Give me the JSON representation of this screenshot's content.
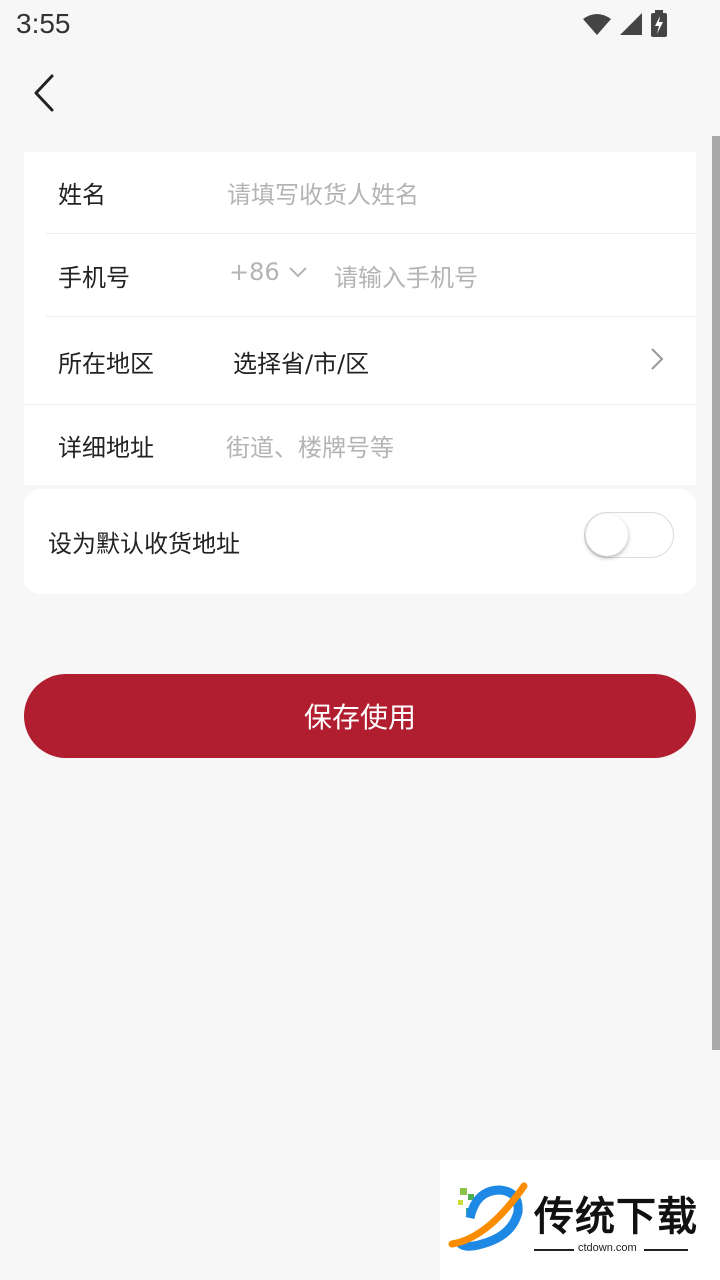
{
  "status_bar": {
    "time": "3:55"
  },
  "form": {
    "name": {
      "label": "姓名",
      "placeholder": "请填写收货人姓名"
    },
    "phone": {
      "label": "手机号",
      "country_code": "+86",
      "placeholder": "请输入手机号"
    },
    "region": {
      "label": "所在地区",
      "value": "选择省/市/区"
    },
    "address": {
      "label": "详细地址",
      "placeholder": "街道、楼牌号等"
    }
  },
  "default_address": {
    "label": "设为默认收货地址",
    "enabled": false
  },
  "save_button": {
    "label": "保存使用"
  },
  "watermark": {
    "title": "传统下载",
    "subtitle": "ctdown.com"
  },
  "colors": {
    "accent": "#b01e2f",
    "background": "#f7f7f7",
    "placeholder": "#b4b4b4"
  }
}
